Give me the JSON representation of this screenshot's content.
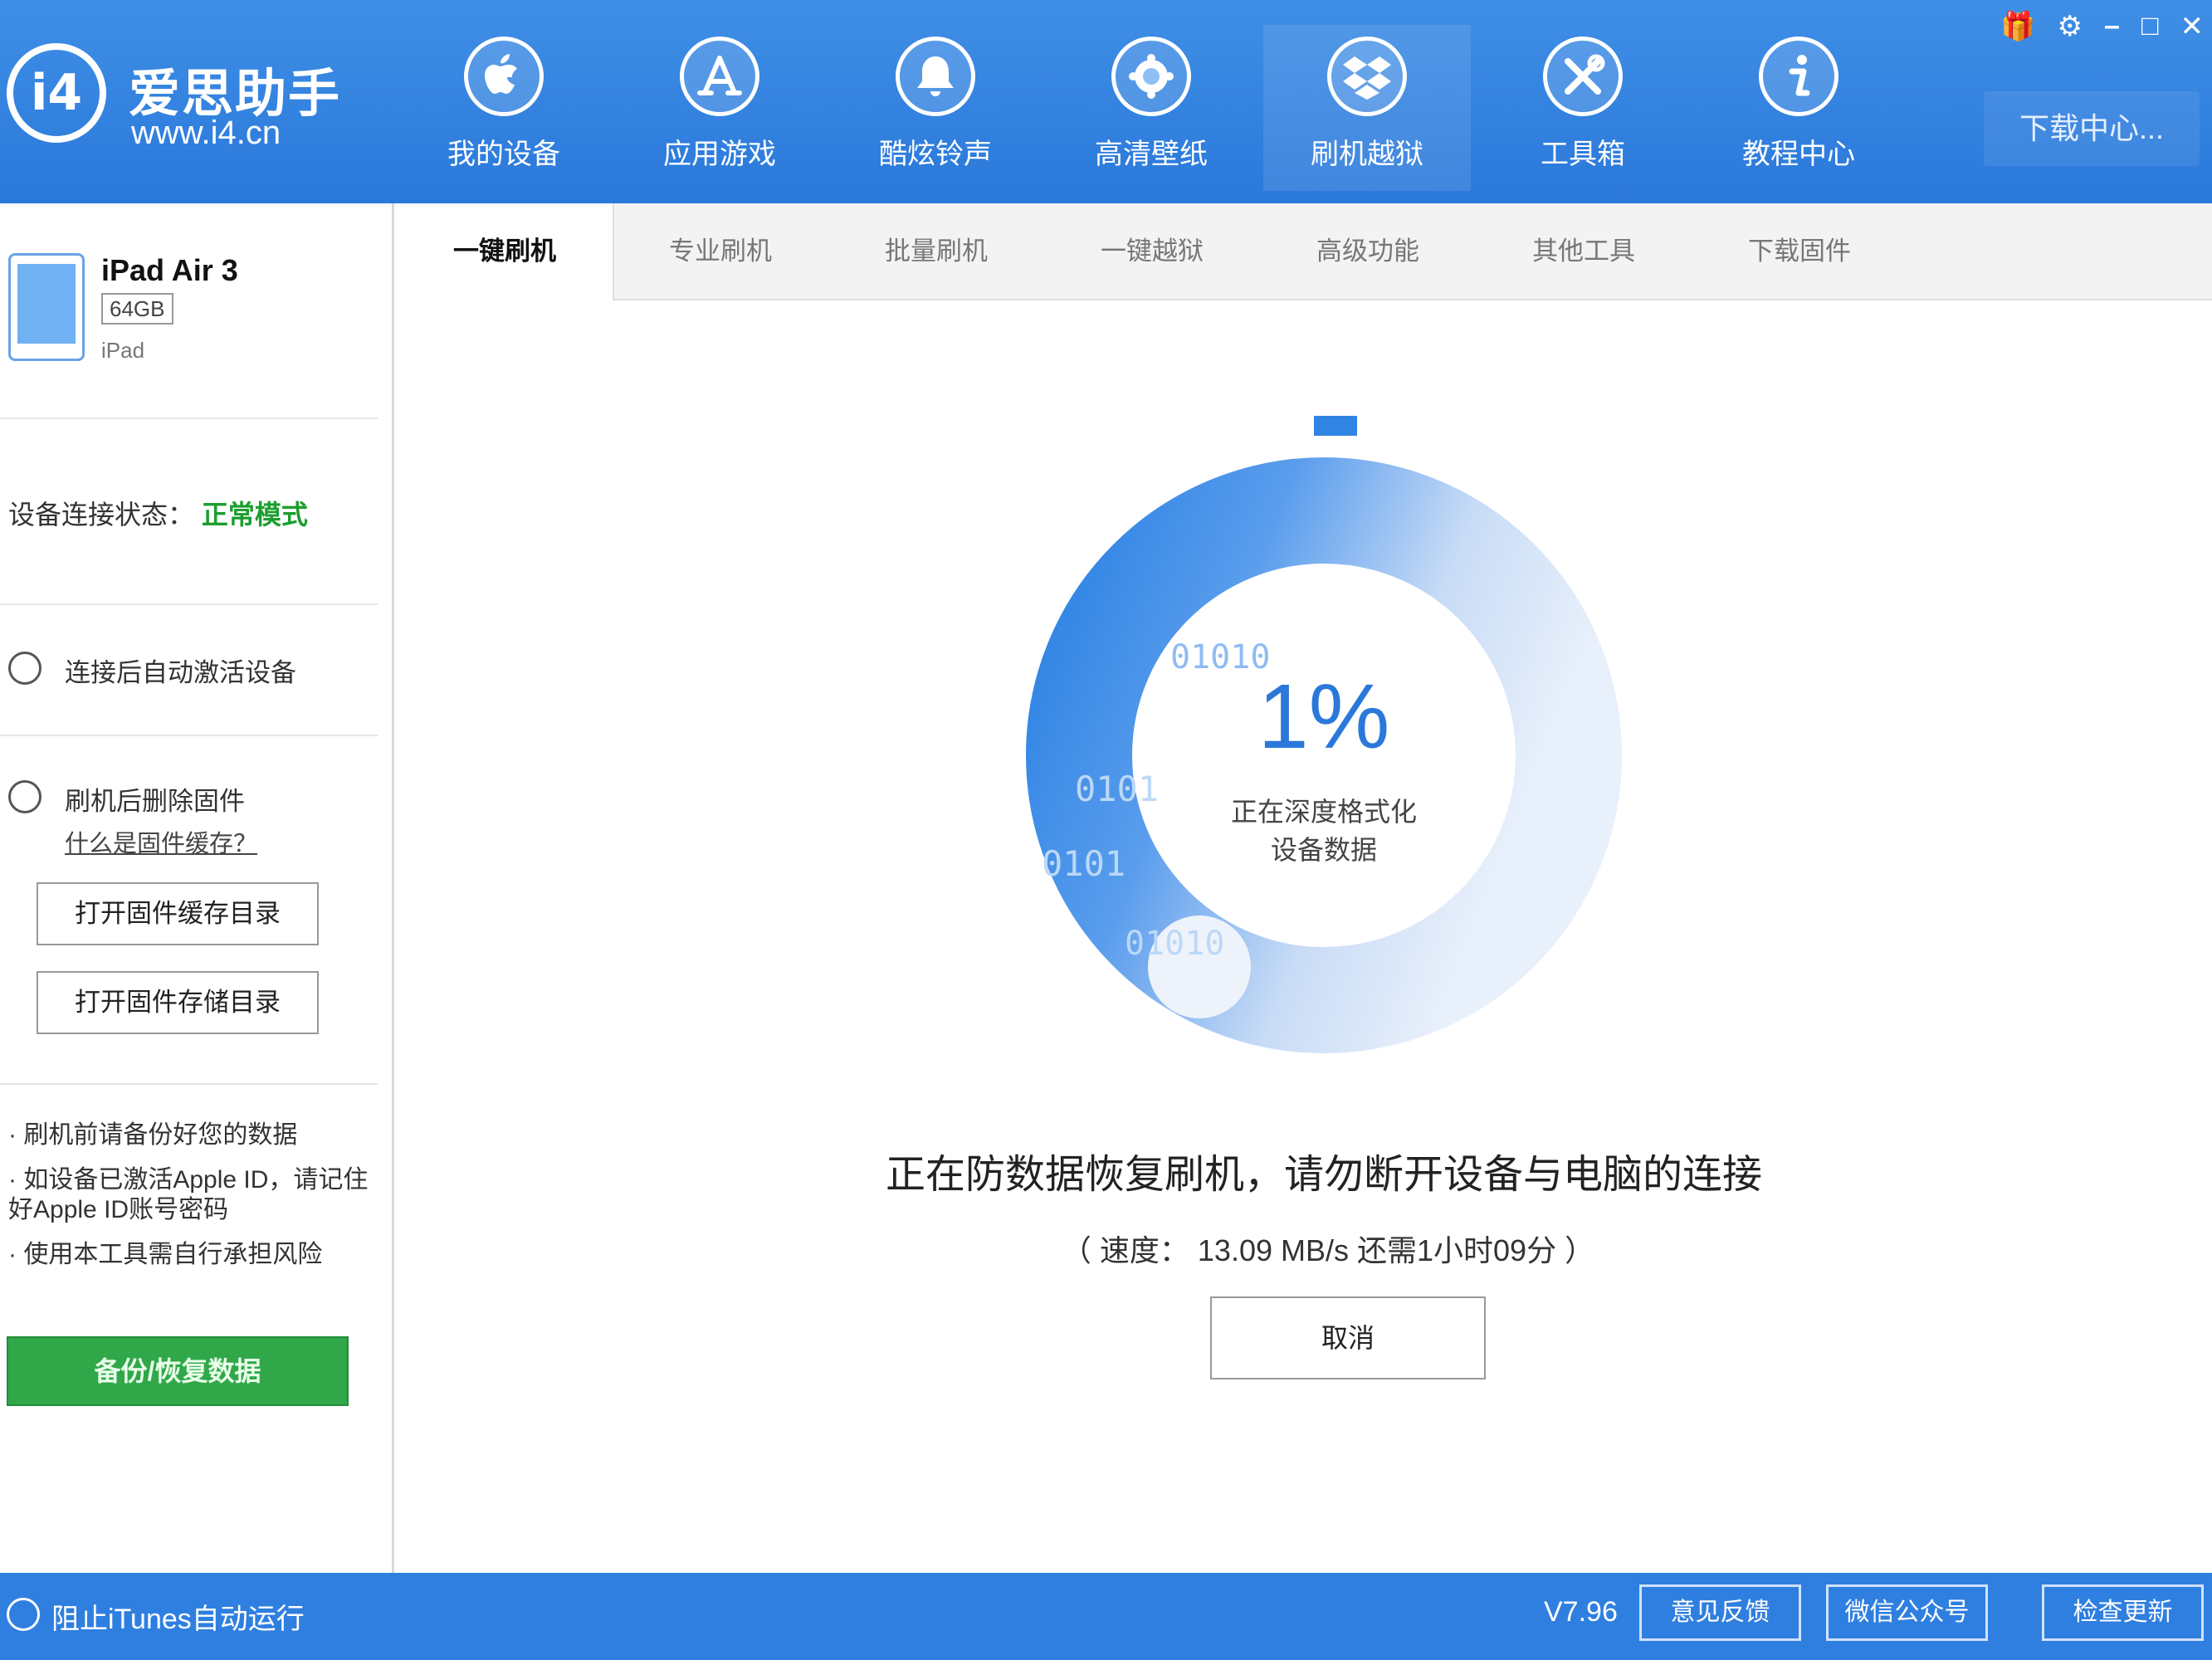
{
  "app": {
    "logo_mark": "i4",
    "name": "爱思助手",
    "url": "www.i4.cn"
  },
  "nav": {
    "items": [
      {
        "label": "我的设备",
        "icon": "apple-icon"
      },
      {
        "label": "应用游戏",
        "icon": "app-store-icon"
      },
      {
        "label": "酷炫铃声",
        "icon": "bell-icon"
      },
      {
        "label": "高清壁纸",
        "icon": "wallpaper-icon"
      },
      {
        "label": "刷机越狱",
        "icon": "dropbox-box-icon",
        "active": true
      },
      {
        "label": "工具箱",
        "icon": "tools-icon"
      },
      {
        "label": "教程中心",
        "icon": "info-icon"
      }
    ],
    "download_label": "下载中心..."
  },
  "window_controls": {
    "gift": "🎁",
    "settings": "⚙",
    "minimize": "–",
    "maximize": "□",
    "close": "✕"
  },
  "device": {
    "name": "iPad Air 3",
    "storage": "64GB",
    "type": "iPad"
  },
  "sidebar": {
    "connection_label": "设备连接状态：",
    "connection_value": "正常模式",
    "radio_auto_activate": "连接后自动激活设备",
    "radio_delete_firmware": "刷机后删除固件",
    "delete_firmware_link": "什么是固件缓存？",
    "btn_open_cache": "打开固件缓存目录",
    "btn_open_storage": "打开固件存储目录",
    "notes": [
      "· 刷机前请备份好您的数据",
      "· 如设备已激活Apple ID，请记住好Apple ID账号密码",
      "· 使用本工具需自行承担风险"
    ],
    "backup_button": "备份/恢复数据"
  },
  "tabs": [
    {
      "label": "一键刷机",
      "active": true
    },
    {
      "label": "专业刷机"
    },
    {
      "label": "批量刷机"
    },
    {
      "label": "一键越狱"
    },
    {
      "label": "高级功能"
    },
    {
      "label": "其他工具"
    },
    {
      "label": "下载固件"
    }
  ],
  "progress": {
    "percent_text": "1%",
    "percent": 0.01,
    "status_line1": "正在深度格式化",
    "status_line2": "设备数据",
    "binary_text_1": "01010",
    "binary_text_2": "0101",
    "binary_text_3": "0101",
    "binary_text_4": "01010",
    "message": "正在防数据恢复刷机，请勿断开设备与电脑的连接",
    "speed": "（ 速度： 13.09 MB/s  还需1小时09分 ）",
    "cancel_label": "取消"
  },
  "statusbar": {
    "itunes_label": "阻止iTunes自动运行",
    "version": "V7.96",
    "buttons": [
      "意见反馈",
      "微信公众号",
      "检查更新"
    ]
  },
  "colors": {
    "brand_blue": "#2a78da",
    "ring_blue": "#2f84e4",
    "ring_light": "#dce8f8",
    "status_green": "#1b9e2e",
    "button_green": "#30a84a"
  }
}
